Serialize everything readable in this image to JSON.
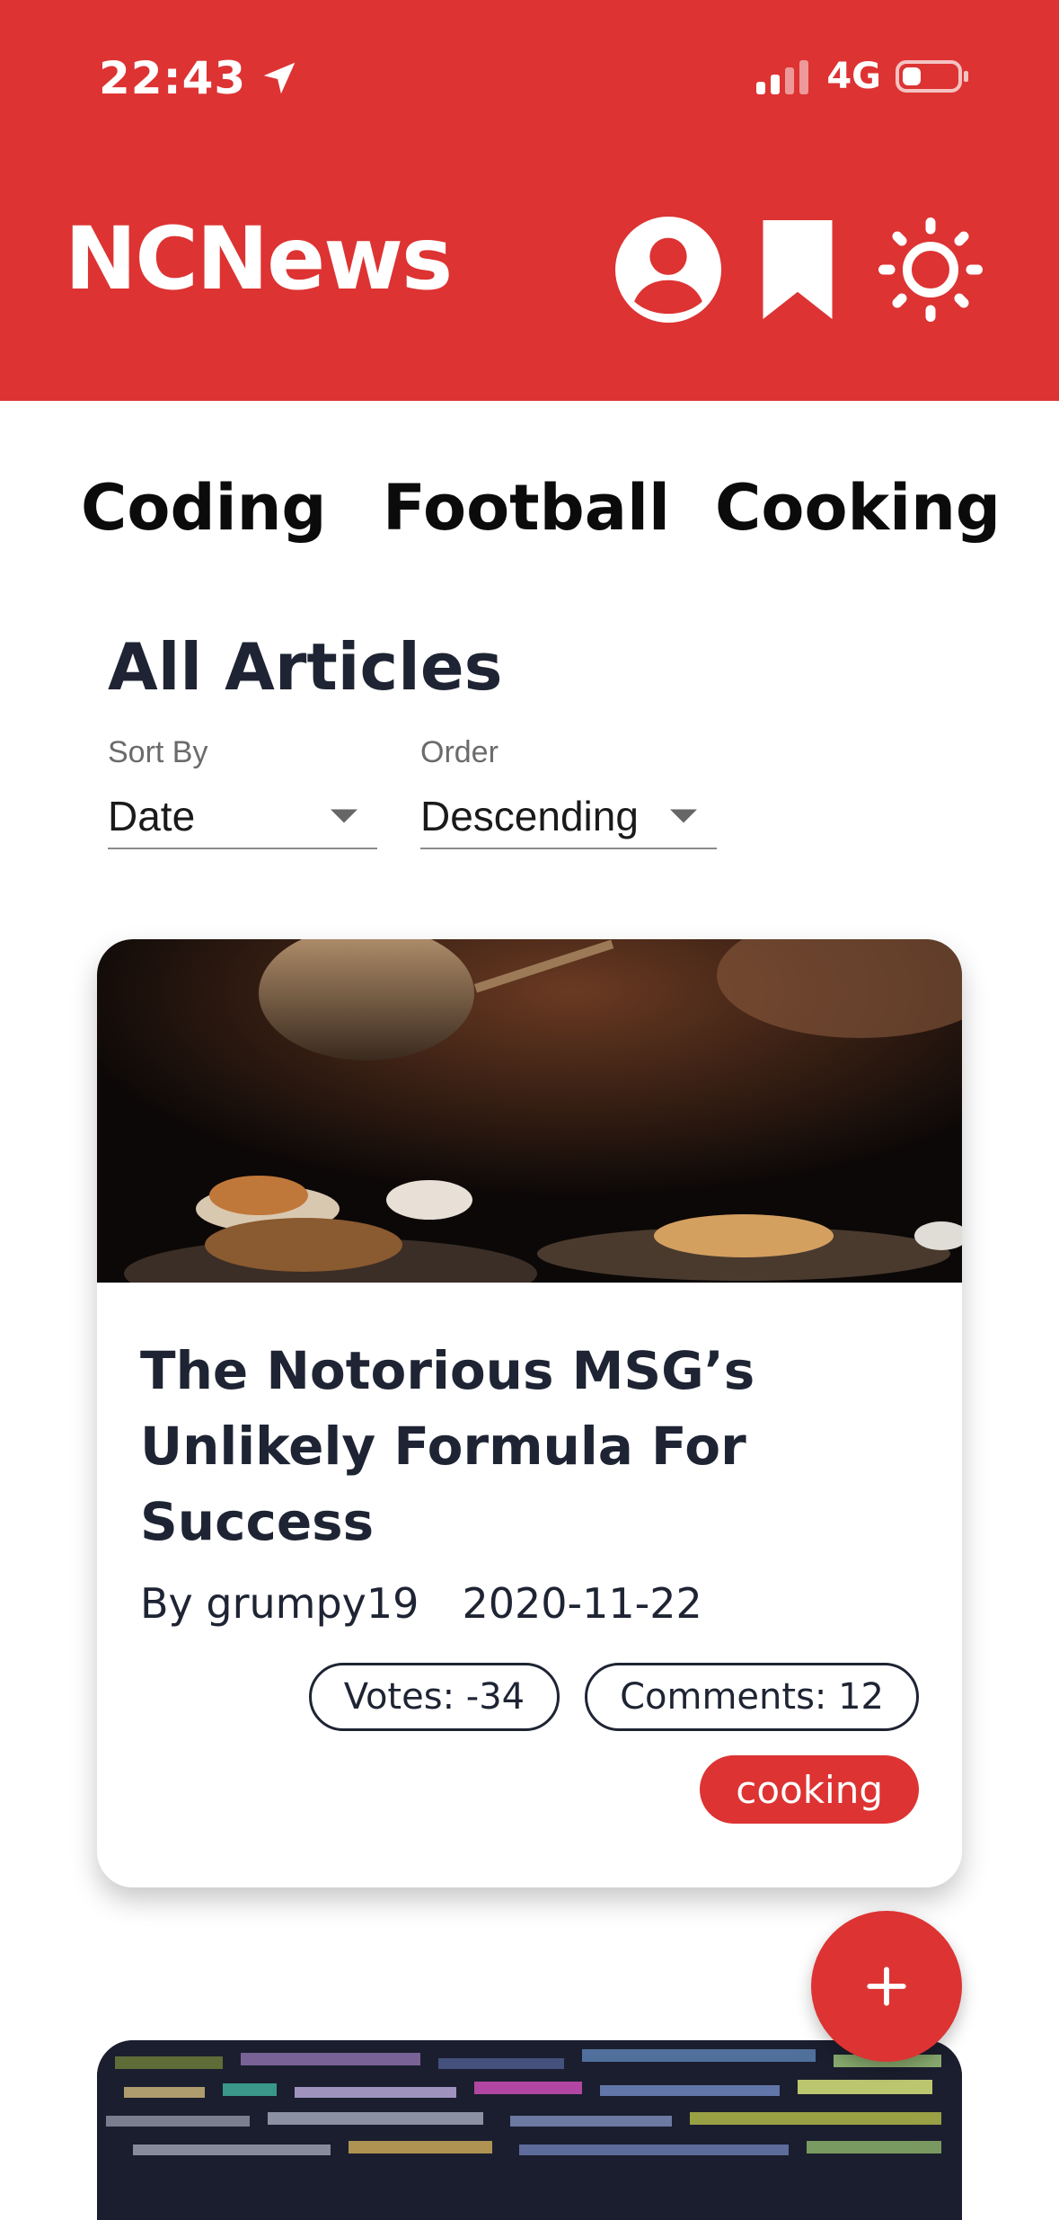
{
  "status_bar": {
    "time": "22:43",
    "network": "4G"
  },
  "header": {
    "brand": "NCNews",
    "brand_color": "#dd3333",
    "icons": [
      "account-icon",
      "bookmark-icon",
      "sun-icon"
    ]
  },
  "topics": [
    {
      "label": "Coding"
    },
    {
      "label": "Football"
    },
    {
      "label": "Cooking"
    }
  ],
  "page": {
    "title": "All Articles"
  },
  "filters": {
    "sort_by": {
      "label": "Sort By",
      "value": "Date"
    },
    "order": {
      "label": "Order",
      "value": "Descending"
    }
  },
  "articles": [
    {
      "title": "The Notorious MSG’s Unlikely Formula For Success",
      "author": "By grumpy19",
      "date": "2020-11-22",
      "votes": "Votes: -34",
      "comments": "Comments: 12",
      "topic": "cooking"
    }
  ],
  "fab": {
    "label": "+"
  }
}
